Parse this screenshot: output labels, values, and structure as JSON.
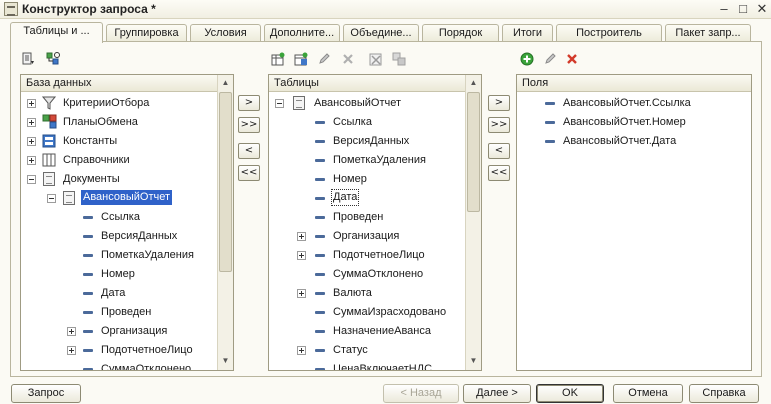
{
  "window": {
    "title": "Конструктор запроса *",
    "minimize_glyph": "–",
    "maximize_glyph": "□",
    "close_glyph": "✕"
  },
  "tabs": [
    {
      "label": "Таблицы и ...",
      "active": true
    },
    {
      "label": "Группировка"
    },
    {
      "label": "Условия"
    },
    {
      "label": "Дополните..."
    },
    {
      "label": "Объедине..."
    },
    {
      "label": "Порядок"
    },
    {
      "label": "Итоги"
    },
    {
      "label": "Построитель"
    },
    {
      "label": "Пакет запр..."
    }
  ],
  "database_pane": {
    "header": "База данных",
    "items": [
      {
        "label": "КритерииОтбора",
        "level": 0,
        "expander": "plus",
        "icon": "filter-icon"
      },
      {
        "label": "ПланыОбмена",
        "level": 0,
        "expander": "plus",
        "icon": "exchange-plans-icon"
      },
      {
        "label": "Константы",
        "level": 0,
        "expander": "plus",
        "icon": "constants-icon"
      },
      {
        "label": "Справочники",
        "level": 0,
        "expander": "plus",
        "icon": "catalogs-icon"
      },
      {
        "label": "Документы",
        "level": 0,
        "expander": "minus",
        "icon": "documents-icon"
      },
      {
        "label": "АвансовыйОтчет",
        "level": 1,
        "expander": "minus",
        "icon": "document-icon",
        "selected": true
      },
      {
        "label": "Ссылка",
        "level": 2,
        "icon": "field-icon"
      },
      {
        "label": "ВерсияДанных",
        "level": 2,
        "icon": "field-icon"
      },
      {
        "label": "ПометкаУдаления",
        "level": 2,
        "icon": "field-icon"
      },
      {
        "label": "Номер",
        "level": 2,
        "icon": "field-icon"
      },
      {
        "label": "Дата",
        "level": 2,
        "icon": "field-icon"
      },
      {
        "label": "Проведен",
        "level": 2,
        "icon": "field-icon"
      },
      {
        "label": "Организация",
        "level": 2,
        "expander": "plus",
        "icon": "field-icon"
      },
      {
        "label": "ПодотчетноеЛицо",
        "level": 2,
        "expander": "plus",
        "icon": "field-icon"
      },
      {
        "label": "СуммаОтклонено",
        "level": 2,
        "icon": "field-icon"
      }
    ]
  },
  "tables_pane": {
    "header": "Таблицы",
    "items": [
      {
        "label": "АвансовыйОтчет",
        "level": 0,
        "expander": "minus",
        "icon": "document-icon"
      },
      {
        "label": "Ссылка",
        "level": 1,
        "icon": "field-icon"
      },
      {
        "label": "ВерсияДанных",
        "level": 1,
        "icon": "field-icon"
      },
      {
        "label": "ПометкаУдаления",
        "level": 1,
        "icon": "field-icon"
      },
      {
        "label": "Номер",
        "level": 1,
        "icon": "field-icon"
      },
      {
        "label": "Дата",
        "level": 1,
        "icon": "field-icon",
        "focused": true
      },
      {
        "label": "Проведен",
        "level": 1,
        "icon": "field-icon"
      },
      {
        "label": "Организация",
        "level": 1,
        "expander": "plus",
        "icon": "field-icon"
      },
      {
        "label": "ПодотчетноеЛицо",
        "level": 1,
        "expander": "plus",
        "icon": "field-icon"
      },
      {
        "label": "СуммаОтклонено",
        "level": 1,
        "icon": "field-icon"
      },
      {
        "label": "Валюта",
        "level": 1,
        "expander": "plus",
        "icon": "field-icon"
      },
      {
        "label": "СуммаИзрасходовано",
        "level": 1,
        "icon": "field-icon"
      },
      {
        "label": "НазначениеАванса",
        "level": 1,
        "icon": "field-icon"
      },
      {
        "label": "Статус",
        "level": 1,
        "expander": "plus",
        "icon": "field-icon"
      },
      {
        "label": "ЦенаВключаетНДС",
        "level": 1,
        "icon": "field-icon"
      }
    ]
  },
  "fields_pane": {
    "header": "Поля",
    "items": [
      {
        "label": "АвансовыйОтчет.Ссылка"
      },
      {
        "label": "АвансовыйОтчет.Номер"
      },
      {
        "label": "АвансовыйОтчет.Дата"
      }
    ]
  },
  "move_buttons_left": [
    ">",
    ">>",
    "<",
    "<<"
  ],
  "move_buttons_right": [
    ">",
    ">>",
    "<",
    "<<"
  ],
  "footer": {
    "query_button": "Запрос",
    "back_button": "< Назад",
    "next_button": "Далее >",
    "ok_button": "OK",
    "cancel_button": "Отмена",
    "help_button": "Справка"
  },
  "colors": {
    "selection": "#2f62c9",
    "add_green": "#3aa33a",
    "delete_red": "#d23a2a"
  }
}
